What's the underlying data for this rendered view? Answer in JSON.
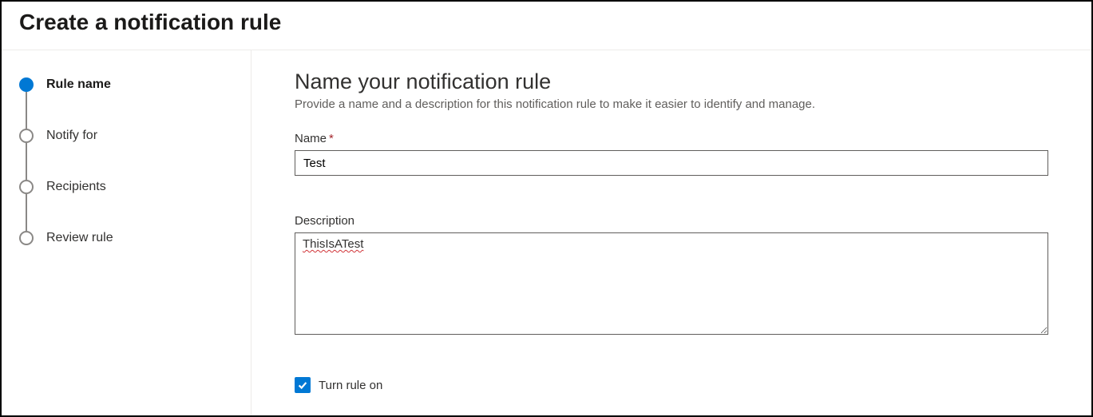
{
  "header": {
    "title": "Create a notification rule"
  },
  "sidebar": {
    "steps": [
      {
        "label": "Rule name",
        "active": true
      },
      {
        "label": "Notify for",
        "active": false
      },
      {
        "label": "Recipients",
        "active": false
      },
      {
        "label": "Review rule",
        "active": false
      }
    ]
  },
  "main": {
    "title": "Name your notification rule",
    "subtitle": "Provide a name and a description for this notification rule to make it easier to identify and manage.",
    "name_field": {
      "label": "Name",
      "required_mark": "*",
      "value": "Test"
    },
    "description_field": {
      "label": "Description",
      "value": "ThisIsATest"
    },
    "toggle": {
      "label": "Turn rule on",
      "checked": true
    }
  }
}
